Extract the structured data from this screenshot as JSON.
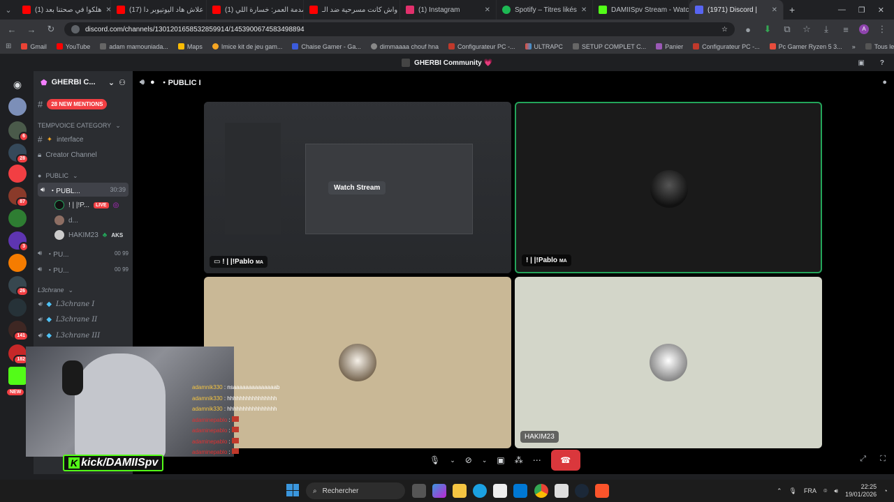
{
  "browser": {
    "tabs": [
      {
        "label": "(1) هلكوا في صحتنا بعد",
        "color": "#ff0000"
      },
      {
        "label": "(17) علاش هاد اليوتيوبر دا",
        "color": "#ff0000"
      },
      {
        "label": "(1) صدمة العمر: خسارة اللي",
        "color": "#ff0000"
      },
      {
        "label": "واش كانت مسرحية ضد الـ",
        "color": "#ff0000"
      },
      {
        "label": "(1) Instagram",
        "color": "#e1306c"
      },
      {
        "label": "Spotify – Titres likés",
        "color": "#1db954"
      },
      {
        "label": "DAMIISpv Stream - Watc",
        "color": "#53fc18"
      },
      {
        "label": "(1971) Discord |",
        "color": "#5865f2"
      }
    ],
    "url": "discord.com/channels/1301201658532859914/1453900674583498894",
    "bookmarks": [
      "Gmail",
      "YouTube",
      "adam mamouniada...",
      "Maps",
      "Imice kit de jeu gam...",
      "Chaise Gamer - Ga...",
      "dimmaaaa chouf hna",
      "Configurateur PC -...",
      "ULTRAPC",
      "SETUP COMPLET C...",
      "Panier",
      "Configurateur PC -...",
      "Pc Gamer Ryzen 5 3...",
      "Tous les favoris"
    ]
  },
  "discord": {
    "community_title": "GHERBI Community 💗",
    "server_name": "GHERBI C...",
    "new_mentions": "28 NEW MENTIONS",
    "server_badges": [
      "6",
      "28",
      "87",
      "3",
      "26",
      "141",
      "182",
      "NEW"
    ],
    "channels": {
      "cat_tempvoice": "TEMPVOICE CATEGORY",
      "interface": "interface",
      "creator": "Creator Channel",
      "cat_public": "PUBLIC",
      "public_active": "・PUBL...",
      "public_timer": "30:39",
      "member1": "! | |!P...",
      "member1_tag": "LIVE",
      "member2": "d...",
      "member3": "HAKIM23",
      "member3_tag": "AKS",
      "pu1": "・PU...",
      "pu1_counts": "00  99",
      "pu2": "・PU...",
      "pu2_counts": "00  99",
      "cat_l3": "L3chrane",
      "l3_1": "L3chrane I",
      "l3_2": "L3chrane II",
      "l3_3": "L3chrane III"
    },
    "stage_title": "・PUBLIC I",
    "watch_stream": "Watch Stream",
    "tile1_name": "! | |!Pablo",
    "tile1_suffix": "MA",
    "tile2_name": "! | |!Pablo",
    "tile2_suffix": "MA",
    "tile4_name": "HAKIM23",
    "chat_lines": [
      {
        "user": "adamnik330",
        "msg": ": nsaaaaaaaaaaaaaab"
      },
      {
        "user": "adamnik330",
        "msg": ": hhhhhhhhhhhhhhhh"
      },
      {
        "user": "adamnik330",
        "msg": ": hhhhhhhhhhhhhhhh"
      },
      {
        "user": "adaminepablo",
        "msg": ":"
      },
      {
        "user": "adaminepablo",
        "msg": ":"
      },
      {
        "user": "adaminepablo",
        "msg": ":"
      },
      {
        "user": "adaminepablo",
        "msg": ":"
      }
    ],
    "kick_overlay": "kick/DAMIISpv"
  },
  "taskbar": {
    "search": "Rechercher",
    "lang": "FRA",
    "time": "22:25",
    "date": "19/01/2026"
  },
  "colors": {
    "discord_bg": "#1e1f22",
    "channel_bg": "#2b2d31",
    "mention_red": "#f23f43",
    "speaking_green": "#23a55a",
    "hangup_red": "#da373c"
  }
}
